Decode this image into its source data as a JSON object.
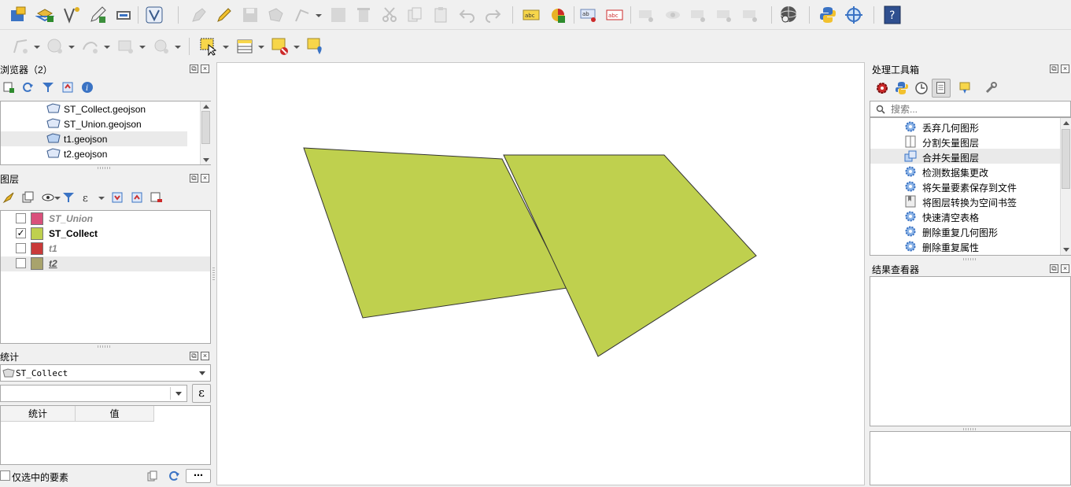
{
  "toolbar1": {
    "icons": [
      "open-project-icon",
      "new-layer-icon",
      "digitize-icon",
      "edit-pen-icon",
      "save-edits-icon",
      "vertex-tool-icon",
      "pencil-icon",
      "save-layer-icon",
      "add-feature-icon",
      "node-tool-icon",
      "field-calc-icon",
      "delete-icon",
      "cut-icon",
      "copy-icon",
      "paste-icon",
      "undo-icon",
      "redo-icon",
      "label-abc-icon",
      "diagram-icon",
      "label-pin-icon",
      "label-change-icon",
      "python-icon",
      "globe-icon",
      "help-icon"
    ]
  },
  "toolbar2": {
    "icons": [
      "select-feature-icon",
      "select-polygon-icon",
      "select-freehand-icon",
      "select-radius-icon",
      "select-by-rect-icon",
      "attribute-table-icon",
      "deselect-icon",
      "select-location-icon"
    ]
  },
  "browser": {
    "title": "浏览器（2）",
    "items": [
      {
        "label": "ST_Collect.geojson"
      },
      {
        "label": "ST_Union.geojson"
      },
      {
        "label": "t1.geojson"
      },
      {
        "label": "t2.geojson"
      }
    ]
  },
  "layers": {
    "title": "图层",
    "items": [
      {
        "label": "ST_Union",
        "checked": "",
        "color": "#d9507b"
      },
      {
        "label": "ST_Collect",
        "checked": "✓",
        "color": "#bfd04e"
      },
      {
        "label": "t1",
        "checked": "",
        "color": "#c93a3a"
      },
      {
        "label": "t2",
        "checked": "",
        "color": "#a8a36c"
      }
    ]
  },
  "stats": {
    "title": "统计",
    "layer_value": "ST_Collect",
    "expression_button": "ε",
    "col_stat": "统计",
    "col_value": "值",
    "selected_only_label": "仅选中的要素",
    "more_button": "⋯"
  },
  "toolbox": {
    "title": "处理工具箱",
    "search_placeholder": "搜索...",
    "items": [
      {
        "label": "丢弃几何图形"
      },
      {
        "label": "分割矢量图层"
      },
      {
        "label": "合并矢量图层"
      },
      {
        "label": "检测数据集更改"
      },
      {
        "label": "将矢量要素保存到文件"
      },
      {
        "label": "将图层转换为空间书签"
      },
      {
        "label": "快速清空表格"
      },
      {
        "label": "删除重复几何图形"
      },
      {
        "label": "删除重复属性"
      }
    ]
  },
  "results": {
    "title": "结果查看器"
  },
  "map": {
    "fill_color": "#bfd04e",
    "stroke_color": "#333333"
  }
}
